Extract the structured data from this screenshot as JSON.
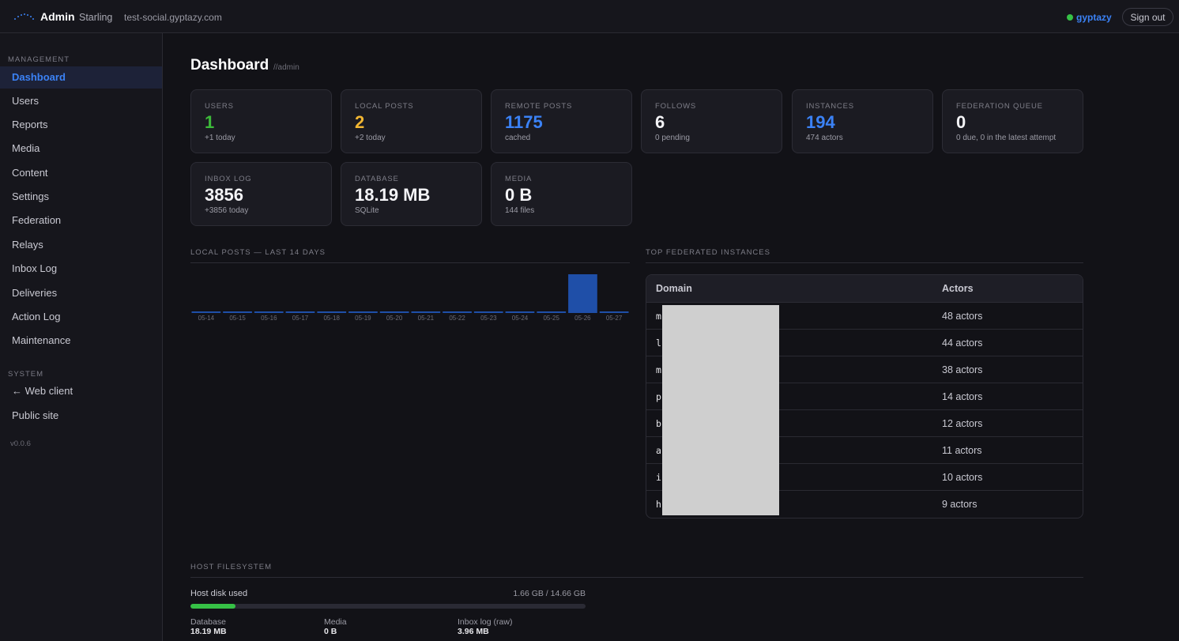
{
  "topbar": {
    "title": "Admin",
    "subtitle": "Starling",
    "host": "test-social.gyptazy.com",
    "user": "gyptazy",
    "signout_label": "Sign out"
  },
  "sidebar": {
    "management_label": "MANAGEMENT",
    "items": [
      "Dashboard",
      "Users",
      "Reports",
      "Media",
      "Content",
      "Settings",
      "Federation",
      "Relays",
      "Inbox Log",
      "Deliveries",
      "Action Log",
      "Maintenance"
    ],
    "active": "Dashboard",
    "system_label": "SYSTEM",
    "system_items": [
      "← Web client",
      "Public site"
    ],
    "version": "v0.0.6"
  },
  "page": {
    "title": "Dashboard",
    "path": "//admin"
  },
  "stats": [
    {
      "label": "USERS",
      "value": "1",
      "sub": "+1 today",
      "color": "#3dbb3a"
    },
    {
      "label": "LOCAL POSTS",
      "value": "2",
      "sub": "+2 today",
      "color": "#f2b632"
    },
    {
      "label": "REMOTE POSTS",
      "value": "1175",
      "sub": "cached",
      "color": "#3b82f6"
    },
    {
      "label": "FOLLOWS",
      "value": "6",
      "sub": "0 pending",
      "color": "#f3f3f6"
    },
    {
      "label": "INSTANCES",
      "value": "194",
      "sub": "474 actors",
      "color": "#3b82f6"
    },
    {
      "label": "FEDERATION QUEUE",
      "value": "0",
      "sub": "0 due, 0 in the latest attempt",
      "color": "#f3f3f6"
    },
    {
      "label": "INBOX LOG",
      "value": "3856",
      "sub": "+3856 today",
      "color": "#f3f3f6"
    },
    {
      "label": "DATABASE",
      "value": "18.19 MB",
      "sub": "SQLite",
      "color": "#f3f3f6"
    },
    {
      "label": "MEDIA",
      "value": "0 B",
      "sub": "144 files",
      "color": "#f3f3f6"
    }
  ],
  "chart_title": "LOCAL POSTS — LAST 14 DAYS",
  "chart_data": {
    "type": "bar",
    "categories": [
      "05-14",
      "05-15",
      "05-16",
      "05-17",
      "05-18",
      "05-19",
      "05-20",
      "05-21",
      "05-22",
      "05-23",
      "05-24",
      "05-25",
      "05-26",
      "05-27"
    ],
    "values": [
      0,
      0,
      0,
      0,
      0,
      0,
      0,
      0,
      0,
      0,
      0,
      0,
      2,
      0
    ],
    "ylim": [
      0,
      2
    ],
    "bar_color": "#1f4fa8",
    "grid": false
  },
  "instances": {
    "title": "TOP FEDERATED INSTANCES",
    "headers": {
      "domain": "Domain",
      "actors": "Actors"
    },
    "rows": [
      {
        "domain": "m",
        "actors": "48 actors"
      },
      {
        "domain": "l",
        "actors": "44 actors"
      },
      {
        "domain": "m",
        "actors": "38 actors"
      },
      {
        "domain": "p",
        "actors": "14 actors"
      },
      {
        "domain": "b",
        "actors": "12 actors"
      },
      {
        "domain": "a",
        "actors": "11 actors"
      },
      {
        "domain": "i",
        "actors": "10 actors"
      },
      {
        "domain": "h",
        "actors": "9 actors"
      }
    ]
  },
  "filesystem": {
    "title": "HOST FILESYSTEM",
    "disk_label": "Host disk used",
    "disk_value": "1.66 GB / 14.66 GB",
    "disk_fraction": 0.113,
    "items": [
      {
        "name": "Database",
        "value": "18.19 MB"
      },
      {
        "name": "Media",
        "value": "0 B"
      },
      {
        "name": "Inbox log (raw)",
        "value": "3.96 MB"
      }
    ]
  }
}
